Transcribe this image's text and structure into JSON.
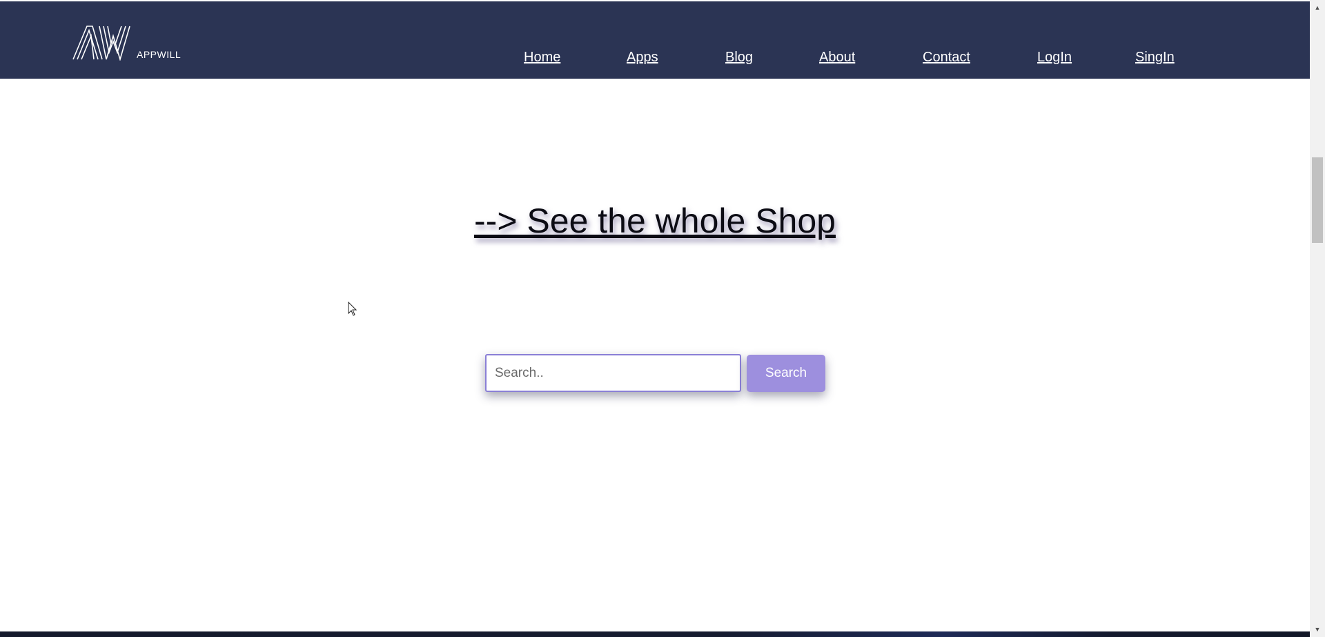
{
  "brand": {
    "name": "APPWILL",
    "logo_mark": "AW"
  },
  "nav": {
    "items": [
      {
        "label": "Home"
      },
      {
        "label": "Apps"
      },
      {
        "label": "Blog"
      },
      {
        "label": "About"
      },
      {
        "label": "Contact"
      },
      {
        "label": "LogIn"
      },
      {
        "label": "SingIn"
      }
    ]
  },
  "main": {
    "shop_link_label": "--> See the whole Shop",
    "search": {
      "placeholder": "Search..",
      "value": "",
      "button_label": "Search"
    }
  },
  "scrollbar": {
    "up_icon": "triangle-up",
    "down_icon": "triangle-down"
  },
  "colors": {
    "navbar_bg": "#2b3454",
    "accent": "#9d8fde",
    "input_border": "#8a7fd6"
  }
}
